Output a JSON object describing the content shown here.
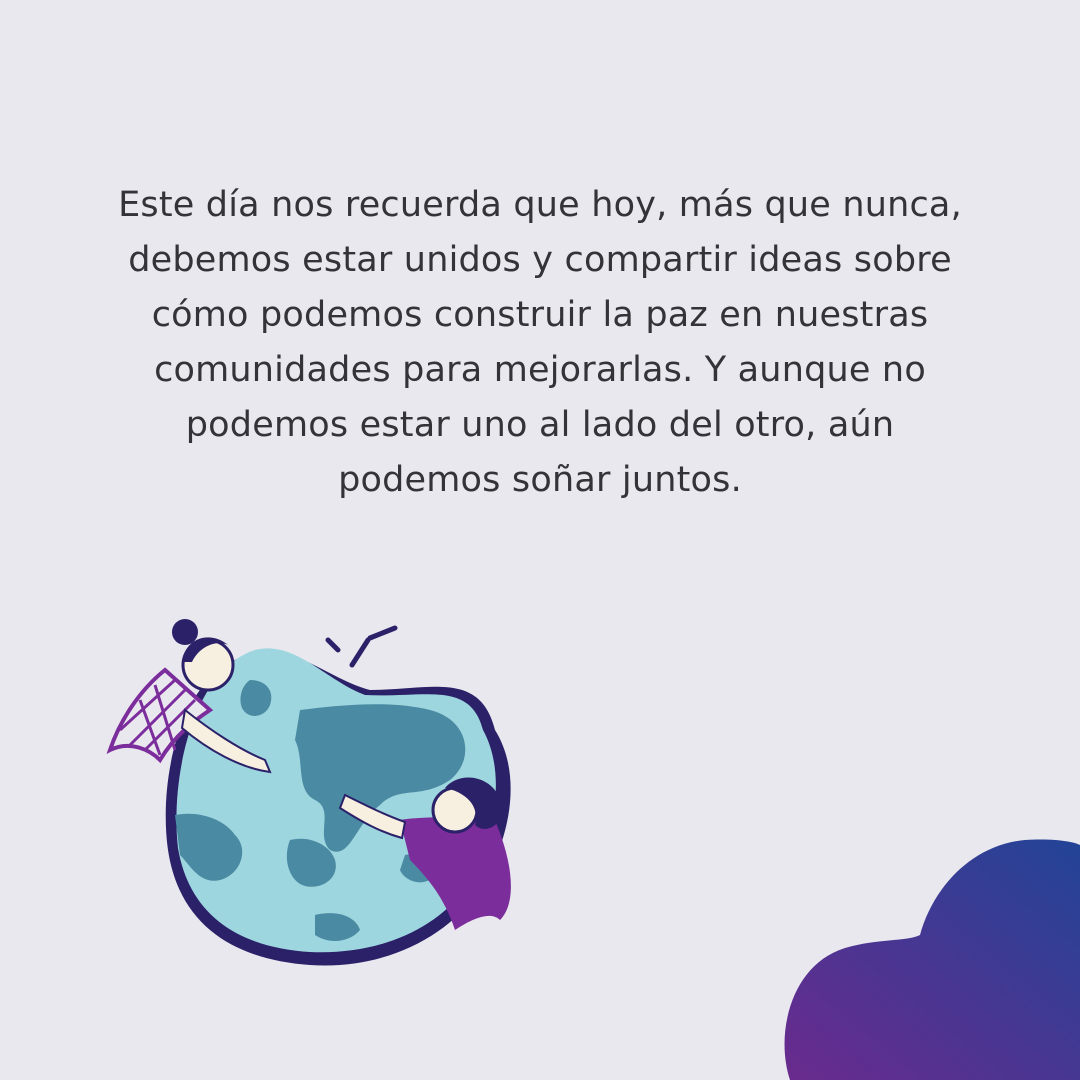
{
  "message": {
    "text": "Este día nos recuerda que hoy, más que nunca,\ndebemos estar unidos y compartir ideas sobre\ncómo podemos construir la paz en nuestras\ncomunidades para mejorarlas. Y aunque no\npodemos estar uno al lado del otro, aún\npodemos soñar juntos."
  },
  "colors": {
    "background": "#E9E8EE",
    "text": "#333338",
    "globe_ocean": "#9ED6DF",
    "globe_land": "#4B8AA3",
    "outline": "#2B2169",
    "shirt_purple": "#7B2D9B",
    "blob_start": "#6A2A8E",
    "blob_end": "#224496"
  },
  "illustration": {
    "icon": "people-hugging-globe-icon"
  },
  "decoration": {
    "icon": "cloud-blob-icon"
  }
}
